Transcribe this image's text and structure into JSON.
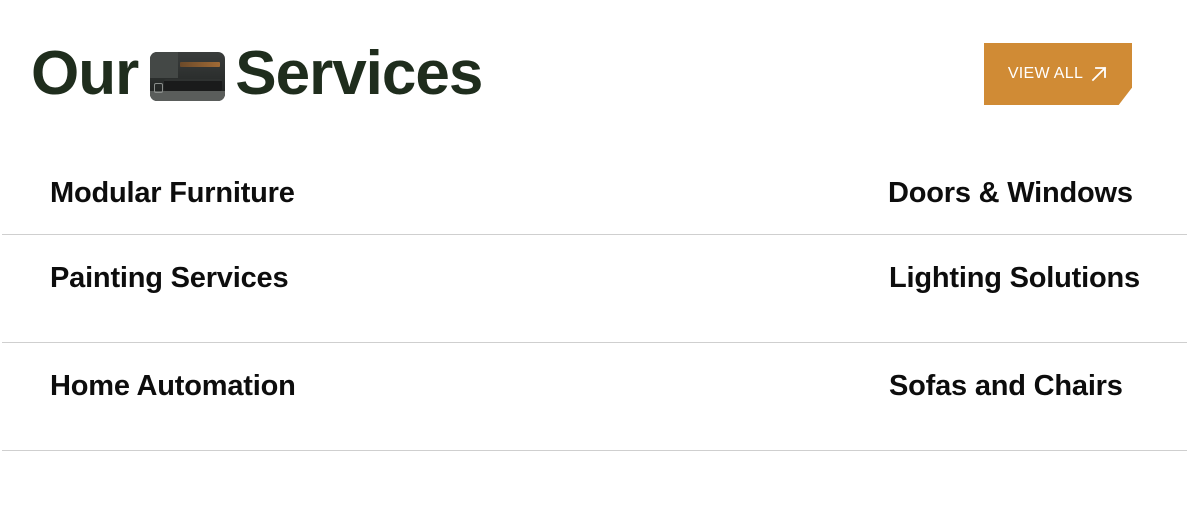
{
  "header": {
    "title_part1": "Our",
    "title_part2": "Services",
    "thumbnail_icon": "interior-photo-thumbnail"
  },
  "view_all_button": {
    "label": "VIEW ALL",
    "icon": "arrow-up-right-icon",
    "color": "#d08b35"
  },
  "services": [
    {
      "left": "Modular Furniture",
      "right": "Doors & Windows"
    },
    {
      "left": "Painting Services",
      "right": "Lighting Solutions"
    },
    {
      "left": "Home Automation",
      "right": "Sofas and Chairs"
    }
  ],
  "colors": {
    "heading": "#1f2d1d",
    "accent": "#d08b35",
    "divider": "#cfcfcf",
    "text": "#0d0d0d"
  }
}
